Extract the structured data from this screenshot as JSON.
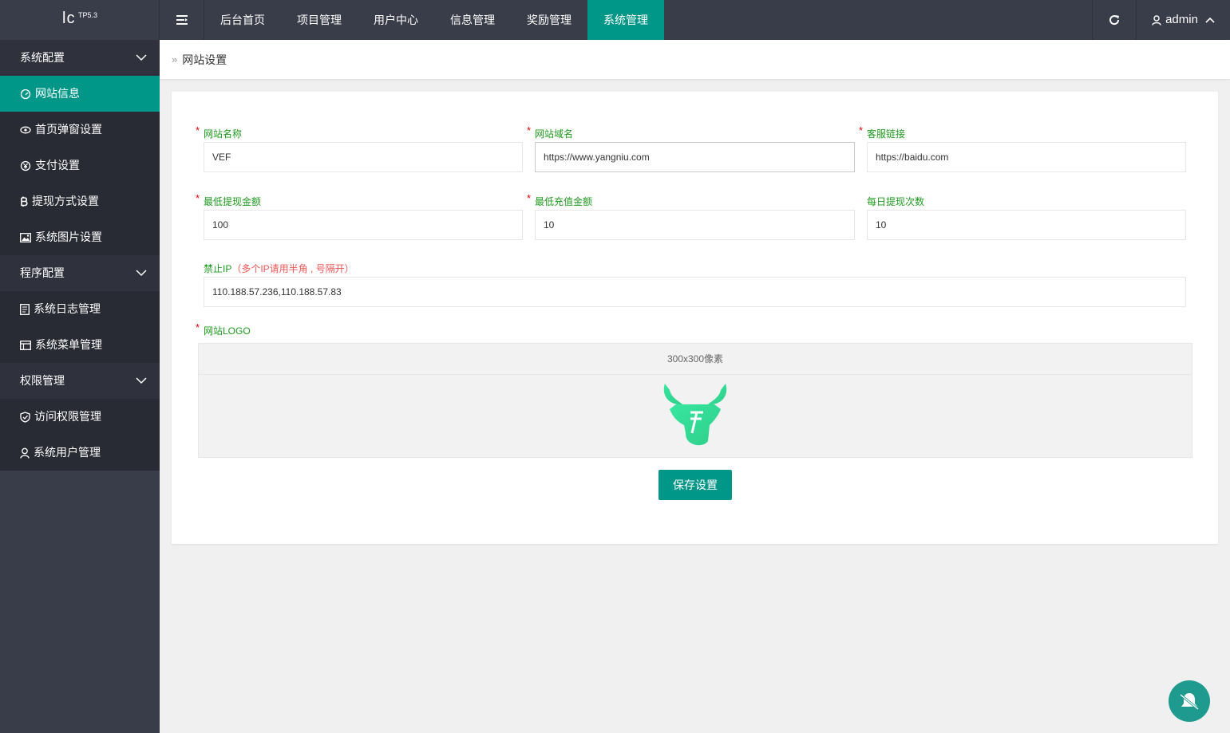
{
  "logo": {
    "main": "lc",
    "sup": "TP5.3"
  },
  "topnav": {
    "items": [
      {
        "label": "后台首页"
      },
      {
        "label": "项目管理"
      },
      {
        "label": "用户中心"
      },
      {
        "label": "信息管理"
      },
      {
        "label": "奖励管理"
      },
      {
        "label": "系统管理"
      }
    ],
    "active_index": 5,
    "user": "admin"
  },
  "sidebar": {
    "groups": [
      {
        "title": "系统配置",
        "items": [
          {
            "label": "网站信息",
            "icon": "dashboard-icon"
          },
          {
            "label": "首页弹窗设置",
            "icon": "eye-icon"
          },
          {
            "label": "支付设置",
            "icon": "yen-icon"
          },
          {
            "label": "提现方式设置",
            "icon": "bitcoin-icon"
          },
          {
            "label": "系统图片设置",
            "icon": "image-icon"
          }
        ]
      },
      {
        "title": "程序配置",
        "items": [
          {
            "label": "系统日志管理",
            "icon": "log-icon"
          },
          {
            "label": "系统菜单管理",
            "icon": "menu-icon"
          }
        ]
      },
      {
        "title": "权限管理",
        "items": [
          {
            "label": "访问权限管理",
            "icon": "shield-icon"
          },
          {
            "label": "系统用户管理",
            "icon": "user-icon"
          }
        ]
      }
    ]
  },
  "breadcrumb": {
    "sep": "»",
    "current": "网站设置"
  },
  "form": {
    "site_name": {
      "label": "网站名称",
      "value": "VEF"
    },
    "site_domain": {
      "label": "网站域名",
      "value": "https://www.yangniu.com"
    },
    "service_link": {
      "label": "客服链接",
      "value": "https://baidu.com"
    },
    "min_withdraw": {
      "label": "最低提现金额",
      "value": "100"
    },
    "min_recharge": {
      "label": "最低充值金额",
      "value": "10"
    },
    "daily_withdraw": {
      "label": "每日提现次数",
      "value": "10"
    },
    "ban_ip": {
      "label": "禁止IP",
      "hint": "（多个IP请用半角 , 号隔开）",
      "value": "110.188.57.236,110.188.57.83"
    },
    "logo": {
      "label": "网站LOGO",
      "size_hint": "300x300像素"
    },
    "save_label": "保存设置"
  },
  "colors": {
    "accent": "#009688",
    "sidebar": "#393d49",
    "label": "#1e9a1e",
    "required": "#ee0000",
    "logo_green": "#3ddc97"
  }
}
